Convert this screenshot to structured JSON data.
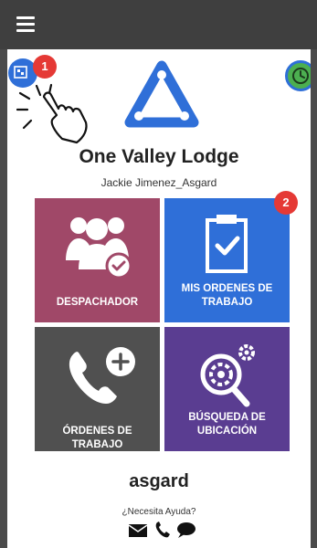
{
  "header": {
    "menu_icon": "hamburger-menu-icon"
  },
  "top_actions": {
    "scanner_icon": "qr-scanner-icon",
    "scanner_badge": "1",
    "tap_hint_icon": "tap-hand-icon",
    "clock_icon": "clock-icon"
  },
  "organization": {
    "logo_icon": "triangle-network-logo",
    "name": "One Valley Lodge",
    "user": "Jackie Jimenez_Asgard"
  },
  "tiles": [
    {
      "id": "dispatch",
      "label": "DESPACHADOR",
      "icon": "group-check-icon",
      "color": "#a04868"
    },
    {
      "id": "my-orders",
      "label": "MIS ORDENES DE TRABAJO",
      "icon": "clipboard-check-icon",
      "color": "#2f6fd8",
      "badge": "2"
    },
    {
      "id": "work-orders",
      "label": "ÓRDENES DE TRABAJO",
      "icon": "phone-plus-icon",
      "color": "#505050"
    },
    {
      "id": "location-search",
      "label": "BÚSQUEDA DE UBICACIÓN",
      "icon": "gear-search-icon",
      "color": "#5a3d91"
    }
  ],
  "footer": {
    "brand": "asgard",
    "help_text": "¿Necesita Ayuda?",
    "contacts": [
      "envelope-icon",
      "phone-icon",
      "chat-bubble-icon"
    ]
  },
  "colors": {
    "accent_blue": "#2f6fd8",
    "badge_red": "#e53935",
    "clock_green": "#4caf50",
    "header_bar": "#3f3f3f"
  }
}
